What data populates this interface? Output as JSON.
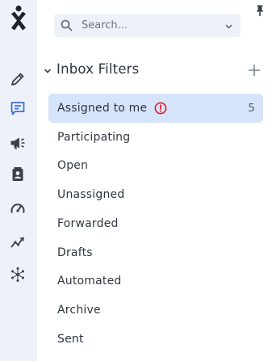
{
  "search": {
    "placeholder": "Search..."
  },
  "section": {
    "title": "Inbox Filters"
  },
  "filters": [
    {
      "label": "Assigned to me",
      "count": "5",
      "active": true,
      "alert": true
    },
    {
      "label": "Participating"
    },
    {
      "label": "Open"
    },
    {
      "label": "Unassigned"
    },
    {
      "label": "Forwarded"
    },
    {
      "label": "Drafts"
    },
    {
      "label": "Automated"
    },
    {
      "label": "Archive"
    },
    {
      "label": "Sent"
    }
  ],
  "rail": {
    "icons": [
      "compose-icon",
      "conversations-icon",
      "campaigns-icon",
      "contacts-icon",
      "dashboard-icon",
      "analytics-icon",
      "integrations-icon"
    ],
    "active": "conversations-icon"
  },
  "colors": {
    "accent": "#3d6fd8",
    "active_bg": "#d6e4fb",
    "alert": "#e0242c",
    "rail_bg": "#eef2f8"
  }
}
